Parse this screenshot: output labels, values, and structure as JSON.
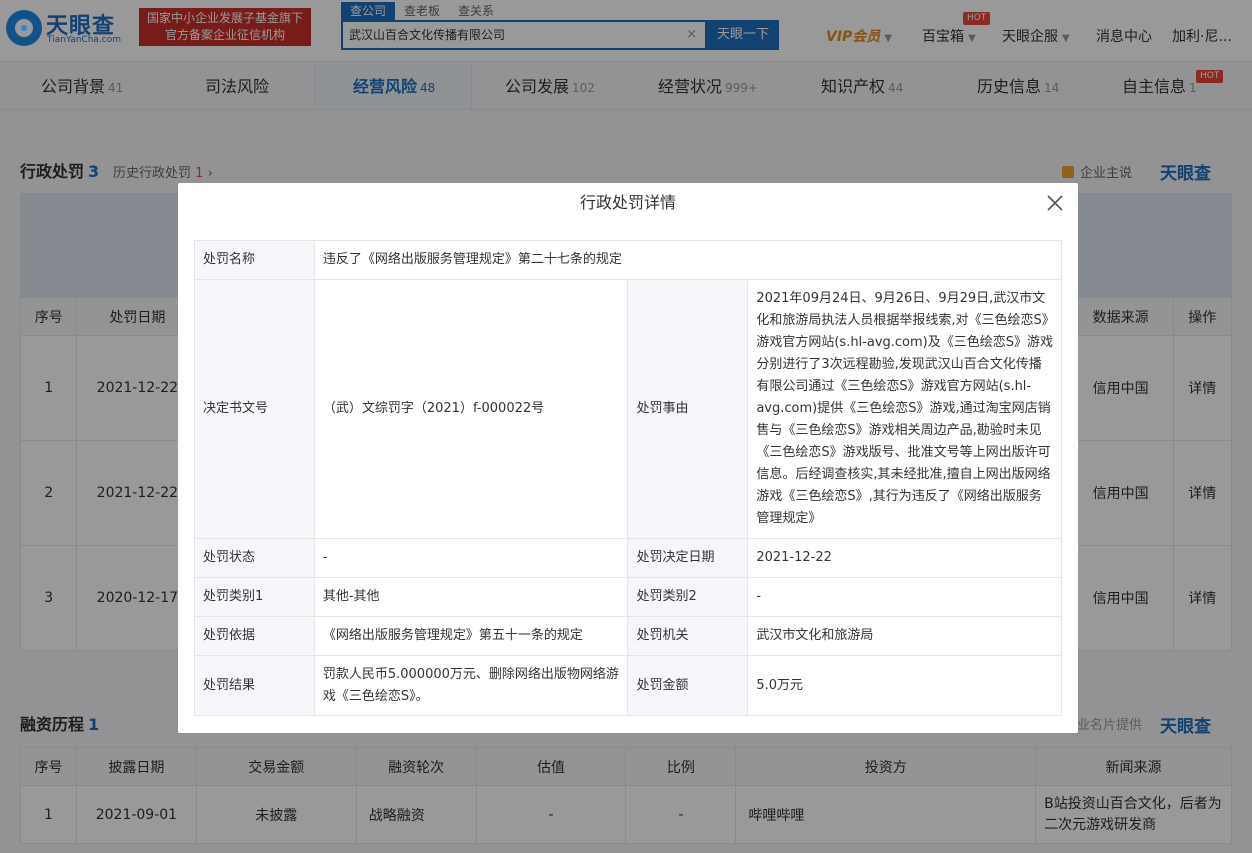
{
  "header": {
    "logo_text": "天眼查",
    "logo_sub": "TianYanCha.com",
    "promo_line1": "国家中小企业发展子基金旗下",
    "promo_line2": "官方备案企业征信机构",
    "search_tabs": [
      "查公司",
      "查老板",
      "查关系"
    ],
    "search_value": "武汉山百合文化传播有限公司",
    "search_clear": "×",
    "search_button": "天眼一下",
    "vip": "VIP会员",
    "baibaoxiang": "百宝箱",
    "hot": "HOT",
    "enterprise": "天眼企服",
    "messages": "消息中心",
    "user": "加利·尼..."
  },
  "subnav": [
    {
      "label": "公司背景",
      "count": "41"
    },
    {
      "label": "司法风险",
      "count": ""
    },
    {
      "label": "经营风险",
      "count": "48"
    },
    {
      "label": "公司发展",
      "count": "102"
    },
    {
      "label": "经营状况",
      "count": "999+"
    },
    {
      "label": "知识产权",
      "count": "44"
    },
    {
      "label": "历史信息",
      "count": "14"
    },
    {
      "label": "自主信息",
      "count": "1"
    }
  ],
  "penalty_section": {
    "title": "行政处罚",
    "count": "3",
    "history_label": "历史行政处罚",
    "history_count": "1",
    "corp_say": "企业主说",
    "brand": "天眼查",
    "columns": [
      "序号",
      "处罚日期",
      "数据来源",
      "操作"
    ],
    "rows": [
      {
        "no": "1",
        "date": "2021-12-22",
        "source": "信用中国",
        "action": "详情"
      },
      {
        "no": "2",
        "date": "2021-12-22",
        "source": "信用中国",
        "action": "详情"
      },
      {
        "no": "3",
        "date": "2020-12-17",
        "source": "信用中国",
        "action": "详情"
      }
    ]
  },
  "financing_section": {
    "title": "融资历程",
    "count": "1",
    "provided": "企业名片提供",
    "brand": "天眼查",
    "columns": [
      "序号",
      "披露日期",
      "交易金额",
      "融资轮次",
      "估值",
      "比例",
      "投资方",
      "新闻来源"
    ],
    "rows": [
      {
        "no": "1",
        "date": "2021-09-01",
        "amount": "未披露",
        "round": "战略融资",
        "valuation": "-",
        "ratio": "-",
        "investor": "哔哩哔哩",
        "news": "B站投资山百合文化，后者为二次元游戏研发商"
      }
    ]
  },
  "modal": {
    "title": "行政处罚详情",
    "penalty_name_label": "处罚名称",
    "penalty_name": "违反了《网络出版服务管理规定》第二十七条的规定",
    "doc_no_label": "决定书文号",
    "doc_no": "（武）文综罚字（2021）f-000022号",
    "reason_label": "处罚事由",
    "reason": "2021年09月24日、9月26日、9月29日,武汉市文化和旅游局执法人员根据举报线索,对《三色绘恋S》游戏官方网站(s.hl-avg.com)及《三色绘恋S》游戏分别进行了3次远程勘验,发现武汉山百合文化传播有限公司通过《三色绘恋S》游戏官方网站(s.hl-avg.com)提供《三色绘恋S》游戏,通过淘宝网店销售与《三色绘恋S》游戏相关周边产品,勘验时未见《三色绘恋S》游戏版号、批准文号等上网出版许可信息。后经调查核实,其未经批准,擅自上网出版网络游戏《三色绘恋S》,其行为违反了《网络出版服务管理规定》",
    "status_label": "处罚状态",
    "status": "-",
    "decision_date_label": "处罚决定日期",
    "decision_date": "2021-12-22",
    "category1_label": "处罚类别1",
    "category1": "其他-其他",
    "category2_label": "处罚类别2",
    "category2": "-",
    "basis_label": "处罚依据",
    "basis": "《网络出版服务管理规定》第五十一条的规定",
    "authority_label": "处罚机关",
    "authority": "武汉市文化和旅游局",
    "result_label": "处罚结果",
    "result": "罚款人民币5.000000万元、删除网络出版物网络游戏《三色绘恋S》。",
    "amount_label": "处罚金额",
    "amount": "5.0万元"
  }
}
